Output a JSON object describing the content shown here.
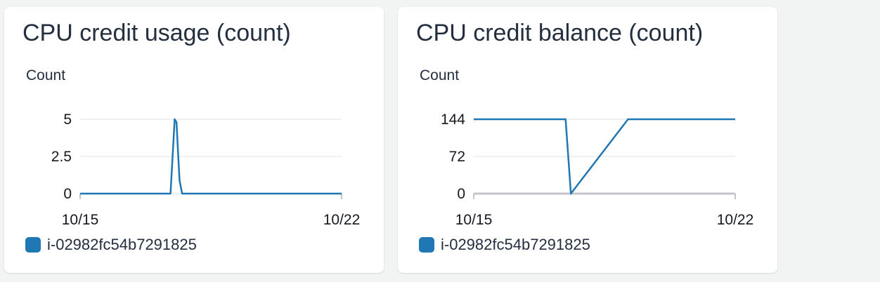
{
  "colors": {
    "series": "#1f77b4",
    "grid": "#e9ebed",
    "baseline_right": "#c6c6cd"
  },
  "chart_data": [
    {
      "type": "line",
      "title": "CPU credit usage (count)",
      "ylabel": "Count",
      "xlabel": "",
      "x_tick_labels": [
        "10/15",
        "10/22"
      ],
      "y_ticks": [
        {
          "value": 0,
          "label": "0"
        },
        {
          "value": 2.5,
          "label": "2.5"
        },
        {
          "value": 5,
          "label": "5"
        }
      ],
      "xlim": [
        0,
        7
      ],
      "ylim": [
        0,
        5
      ],
      "grid": true,
      "legend_position": "bottom-left",
      "series": [
        {
          "name": "i-02982fc54b7291825",
          "points": [
            [
              0,
              0
            ],
            [
              2.42,
              0
            ],
            [
              2.53,
              5
            ],
            [
              2.58,
              4.8
            ],
            [
              2.66,
              0.9
            ],
            [
              2.73,
              0
            ],
            [
              7,
              0
            ]
          ]
        }
      ]
    },
    {
      "type": "line",
      "title": "CPU credit balance (count)",
      "ylabel": "Count",
      "xlabel": "",
      "x_tick_labels": [
        "10/15",
        "10/22"
      ],
      "y_ticks": [
        {
          "value": 0,
          "label": "0"
        },
        {
          "value": 72,
          "label": "72"
        },
        {
          "value": 144,
          "label": "144"
        }
      ],
      "xlim": [
        0,
        7
      ],
      "ylim": [
        0,
        144
      ],
      "grid": true,
      "legend_position": "bottom-left",
      "series": [
        {
          "name": "i-02982fc54b7291825",
          "points": [
            [
              0,
              144
            ],
            [
              2.46,
              144
            ],
            [
              2.6,
              0
            ],
            [
              4.13,
              144
            ],
            [
              7,
              144
            ]
          ]
        }
      ]
    }
  ]
}
